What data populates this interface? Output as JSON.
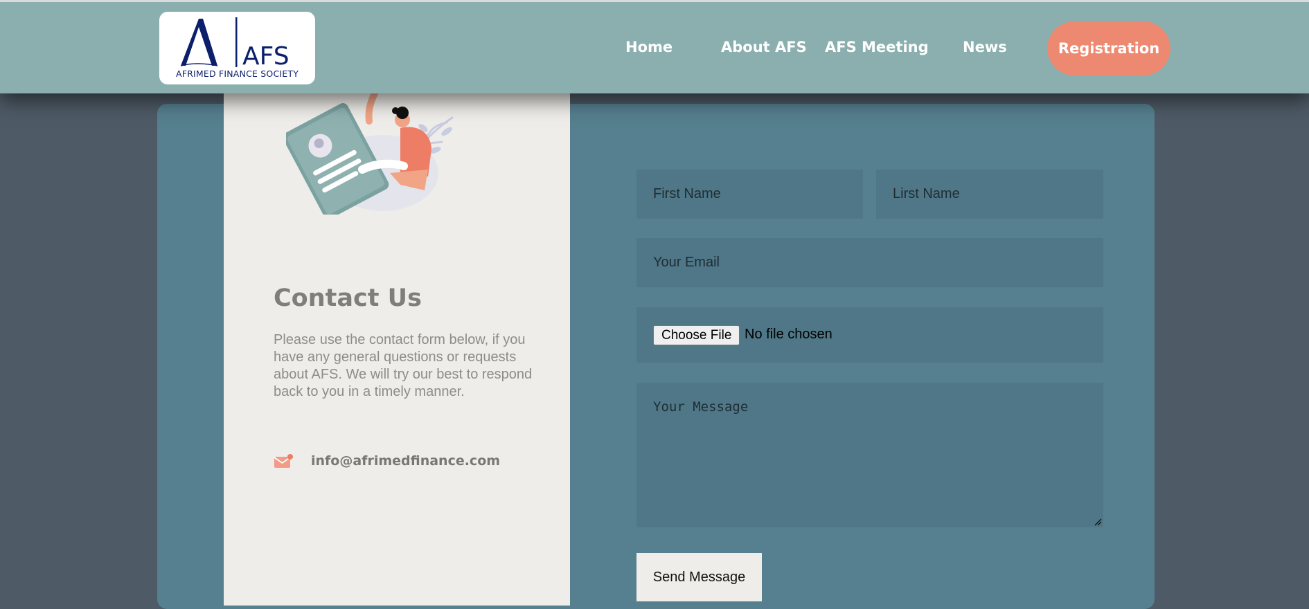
{
  "header": {
    "logo": {
      "letters": "AFS",
      "subtitle": "AFRIMED FINANCE SOCIETY",
      "color": "#0c1f6b"
    },
    "nav": [
      {
        "label": "Home"
      },
      {
        "label": "About AFS"
      },
      {
        "label": "AFS Meeting"
      },
      {
        "label": "News"
      }
    ],
    "registration_label": "Registration",
    "accent": "#ee8971"
  },
  "contact": {
    "title": "Contact Us",
    "description": "Please use the contact form below, if you have any general questions or requests about AFS. We will try our best to respond back to you in a timely manner.",
    "email_icon": "envelope-icon",
    "email": "info@afrimedfinance.com"
  },
  "form": {
    "first_name_placeholder": "First Name",
    "last_name_placeholder": "Lirst Name",
    "email_placeholder": "Your Email",
    "choose_file_label": "Choose File",
    "no_file_text": "No file chosen",
    "message_placeholder": "Your Message",
    "send_label": "Send Message"
  }
}
